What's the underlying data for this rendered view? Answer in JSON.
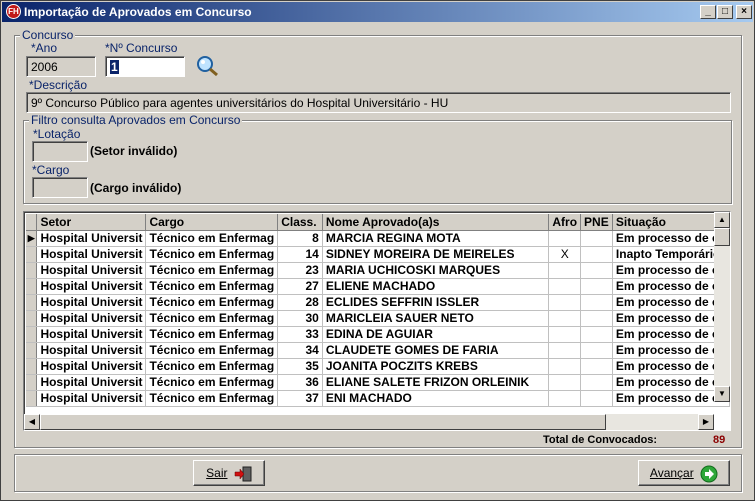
{
  "window": {
    "app_icon_text": "FH",
    "title": "Importação de Aprovados em Concurso",
    "min_glyph": "_",
    "max_glyph": "□",
    "close_glyph": "×"
  },
  "concurso": {
    "group_title": "Concurso",
    "ano_label": "*Ano",
    "ano_value": "2006",
    "numero_label": "*Nº Concurso",
    "numero_value": "1",
    "descricao_label": "*Descrição",
    "descricao_value": "9º Concurso Público para agentes universitários do Hospital Universitário - HU"
  },
  "filtro": {
    "group_title": "Filtro consulta Aprovados em Concurso",
    "lotacao_label": "*Lotação",
    "lotacao_status": "(Setor inválido)",
    "cargo_label": "*Cargo",
    "cargo_status": "(Cargo inválido)"
  },
  "grid": {
    "columns": [
      "Setor",
      "Cargo",
      "Class.",
      "Nome Aprovado(a)s",
      "Afro",
      "PNE",
      "Situação"
    ],
    "rows": [
      {
        "setor": "Hospital Universit",
        "cargo": "Técnico em Enfermag",
        "class": "8",
        "nome": "MARCIA REGINA MOTA",
        "afro": "",
        "pne": "",
        "situacao": "Em processo de co"
      },
      {
        "setor": "Hospital Universit",
        "cargo": "Técnico em Enfermag",
        "class": "14",
        "nome": "SIDNEY MOREIRA DE MEIRELES",
        "afro": "X",
        "pne": "",
        "situacao": "Inapto Temporário"
      },
      {
        "setor": "Hospital Universit",
        "cargo": "Técnico em Enfermag",
        "class": "23",
        "nome": "MARIA UCHICOSKI MARQUES",
        "afro": "",
        "pne": "",
        "situacao": "Em processo de co"
      },
      {
        "setor": "Hospital Universit",
        "cargo": "Técnico em Enfermag",
        "class": "27",
        "nome": "ELIENE MACHADO",
        "afro": "",
        "pne": "",
        "situacao": "Em processo de co"
      },
      {
        "setor": "Hospital Universit",
        "cargo": "Técnico em Enfermag",
        "class": "28",
        "nome": "ECLIDES SEFFRIN ISSLER",
        "afro": "",
        "pne": "",
        "situacao": "Em processo de co"
      },
      {
        "setor": "Hospital Universit",
        "cargo": "Técnico em Enfermag",
        "class": "30",
        "nome": "MARICLEIA SAUER NETO",
        "afro": "",
        "pne": "",
        "situacao": "Em processo de co"
      },
      {
        "setor": "Hospital Universit",
        "cargo": "Técnico em Enfermag",
        "class": "33",
        "nome": "EDINA DE AGUIAR",
        "afro": "",
        "pne": "",
        "situacao": "Em processo de co"
      },
      {
        "setor": "Hospital Universit",
        "cargo": "Técnico em Enfermag",
        "class": "34",
        "nome": "CLAUDETE GOMES DE FARIA",
        "afro": "",
        "pne": "",
        "situacao": "Em processo de co"
      },
      {
        "setor": "Hospital Universit",
        "cargo": "Técnico em Enfermag",
        "class": "35",
        "nome": "JOANITA POCZITS KREBS",
        "afro": "",
        "pne": "",
        "situacao": "Em processo de co"
      },
      {
        "setor": "Hospital Universit",
        "cargo": "Técnico em Enfermag",
        "class": "36",
        "nome": "ELIANE SALETE FRIZON ORLEINIK",
        "afro": "",
        "pne": "",
        "situacao": "Em processo de co"
      },
      {
        "setor": "Hospital Universit",
        "cargo": "Técnico em Enfermag",
        "class": "37",
        "nome": "ENI MACHADO",
        "afro": "",
        "pne": "",
        "situacao": "Em processo de co"
      }
    ],
    "current_row_marker": "▶"
  },
  "footer": {
    "total_label": "Total de Convocados:",
    "total_value": "89",
    "sair_label": "Sair",
    "avancar_label": "Avançar"
  },
  "colors": {
    "title_start": "#0a246a",
    "title_end": "#a6caf0",
    "label_blue": "#0a246a",
    "total_red": "#8b0000"
  },
  "icons": {
    "search": "magnifier-icon",
    "exit": "exit-door-icon",
    "next": "green-arrow-icon"
  }
}
